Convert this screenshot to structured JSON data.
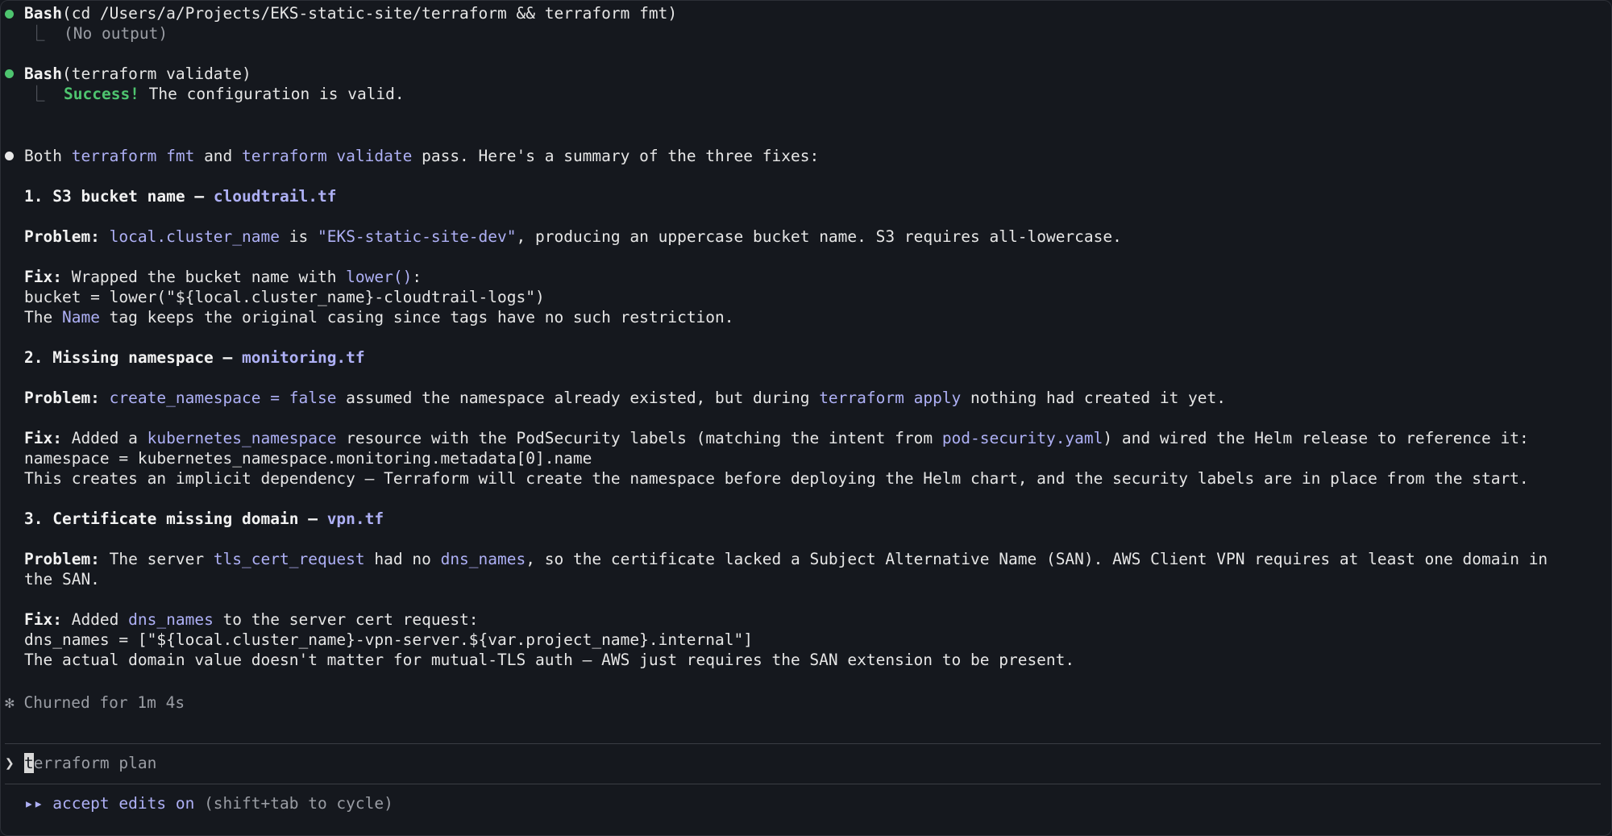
{
  "tool_calls": [
    {
      "name": "Bash",
      "command": "(cd /Users/a/Projects/EKS-static-site/terraform && terraform fmt)",
      "output": "(No output)"
    },
    {
      "name": "Bash",
      "command": "(terraform validate)",
      "output_bold": "Success!",
      "output_rest": " The configuration is valid."
    }
  ],
  "tree_glyph": "⎿",
  "intro": {
    "pre": "Both ",
    "cmd1": "terraform fmt",
    "mid": " and ",
    "cmd2": "terraform validate",
    "post": " pass. Here's a summary of the three fixes:"
  },
  "fixes": [
    {
      "heading": "1. S3 bucket name – ",
      "file": "cloudtrail.tf",
      "problem_label": "Problem:",
      "problem_parts": [
        {
          "t": " ",
          "hl": false
        },
        {
          "t": "local.cluster_name",
          "hl": true
        },
        {
          "t": " is ",
          "hl": false
        },
        {
          "t": "\"EKS-static-site-dev\"",
          "hl": true
        },
        {
          "t": ", producing an uppercase bucket name. S3 requires all-lowercase.",
          "hl": false
        }
      ],
      "fix_label": "Fix:",
      "fix_parts": [
        {
          "t": " Wrapped the bucket name with ",
          "hl": false
        },
        {
          "t": "lower()",
          "hl": true
        },
        {
          "t": ":",
          "hl": false
        }
      ],
      "code": "bucket = lower(\"${local.cluster_name}-cloudtrail-logs\")",
      "note_parts": [
        {
          "t": "The ",
          "hl": false
        },
        {
          "t": "Name",
          "hl": true
        },
        {
          "t": " tag keeps the original casing since tags have no such restriction.",
          "hl": false
        }
      ]
    },
    {
      "heading": "2. Missing namespace – ",
      "file": "monitoring.tf",
      "problem_label": "Problem:",
      "problem_parts": [
        {
          "t": " ",
          "hl": false
        },
        {
          "t": "create_namespace = false",
          "hl": true
        },
        {
          "t": " assumed the namespace already existed, but during ",
          "hl": false
        },
        {
          "t": "terraform apply",
          "hl": true
        },
        {
          "t": " nothing had created it yet.",
          "hl": false
        }
      ],
      "fix_label": "Fix:",
      "fix_parts": [
        {
          "t": " Added a ",
          "hl": false
        },
        {
          "t": "kubernetes_namespace",
          "hl": true
        },
        {
          "t": " resource with the PodSecurity labels (matching the intent from ",
          "hl": false
        },
        {
          "t": "pod-security.yaml",
          "hl": true
        },
        {
          "t": ") and wired the Helm release to reference it:",
          "hl": false
        }
      ],
      "code": "namespace = kubernetes_namespace.monitoring.metadata[0].name",
      "note_parts": [
        {
          "t": "This creates an implicit dependency – Terraform will create the namespace before deploying the Helm chart, and the security labels are in place from the start.",
          "hl": false
        }
      ]
    },
    {
      "heading": "3. Certificate missing domain – ",
      "file": "vpn.tf",
      "problem_label": "Problem:",
      "problem_parts": [
        {
          "t": " The server ",
          "hl": false
        },
        {
          "t": "tls_cert_request",
          "hl": true
        },
        {
          "t": " had no ",
          "hl": false
        },
        {
          "t": "dns_names",
          "hl": true
        },
        {
          "t": ", so the certificate lacked a Subject Alternative Name (SAN). AWS Client VPN requires at least one domain in",
          "hl": false
        }
      ],
      "problem_cont": "the SAN.",
      "fix_label": "Fix:",
      "fix_parts": [
        {
          "t": " Added ",
          "hl": false
        },
        {
          "t": "dns_names",
          "hl": true
        },
        {
          "t": " to the server cert request:",
          "hl": false
        }
      ],
      "code": "dns_names = [\"${local.cluster_name}-vpn-server.${var.project_name}.internal\"]",
      "note_parts": [
        {
          "t": "The actual domain value doesn't matter for mutual-TLS auth – AWS just requires the SAN extension to be present.",
          "hl": false
        }
      ]
    }
  ],
  "status": {
    "glyph": "✻",
    "text": "Churned for 1m 4s"
  },
  "prompt": {
    "arrow": "❯",
    "placeholder_first": "t",
    "placeholder_rest": "erraform plan"
  },
  "footer": {
    "arrows": "▸▸",
    "mode": " accept edits on",
    "hint": " (shift+tab to cycle)"
  },
  "colors": {
    "background": "#15181e",
    "accent": "#aeb0f5",
    "success": "#4ec46f"
  }
}
